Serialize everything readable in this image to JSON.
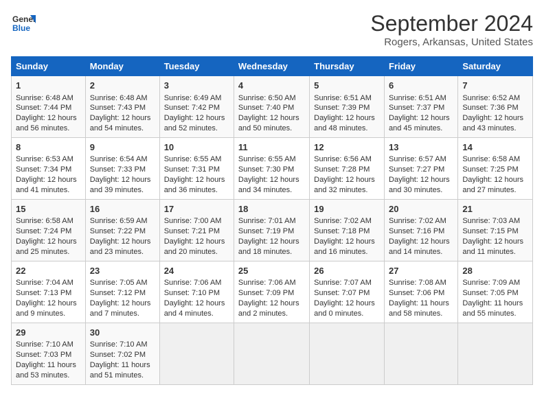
{
  "logo": {
    "line1": "General",
    "line2": "Blue"
  },
  "title": "September 2024",
  "subtitle": "Rogers, Arkansas, United States",
  "headers": [
    "Sunday",
    "Monday",
    "Tuesday",
    "Wednesday",
    "Thursday",
    "Friday",
    "Saturday"
  ],
  "weeks": [
    [
      {
        "day": "1",
        "lines": [
          "Sunrise: 6:48 AM",
          "Sunset: 7:44 PM",
          "Daylight: 12 hours",
          "and 56 minutes."
        ]
      },
      {
        "day": "2",
        "lines": [
          "Sunrise: 6:48 AM",
          "Sunset: 7:43 PM",
          "Daylight: 12 hours",
          "and 54 minutes."
        ]
      },
      {
        "day": "3",
        "lines": [
          "Sunrise: 6:49 AM",
          "Sunset: 7:42 PM",
          "Daylight: 12 hours",
          "and 52 minutes."
        ]
      },
      {
        "day": "4",
        "lines": [
          "Sunrise: 6:50 AM",
          "Sunset: 7:40 PM",
          "Daylight: 12 hours",
          "and 50 minutes."
        ]
      },
      {
        "day": "5",
        "lines": [
          "Sunrise: 6:51 AM",
          "Sunset: 7:39 PM",
          "Daylight: 12 hours",
          "and 48 minutes."
        ]
      },
      {
        "day": "6",
        "lines": [
          "Sunrise: 6:51 AM",
          "Sunset: 7:37 PM",
          "Daylight: 12 hours",
          "and 45 minutes."
        ]
      },
      {
        "day": "7",
        "lines": [
          "Sunrise: 6:52 AM",
          "Sunset: 7:36 PM",
          "Daylight: 12 hours",
          "and 43 minutes."
        ]
      }
    ],
    [
      {
        "day": "8",
        "lines": [
          "Sunrise: 6:53 AM",
          "Sunset: 7:34 PM",
          "Daylight: 12 hours",
          "and 41 minutes."
        ]
      },
      {
        "day": "9",
        "lines": [
          "Sunrise: 6:54 AM",
          "Sunset: 7:33 PM",
          "Daylight: 12 hours",
          "and 39 minutes."
        ]
      },
      {
        "day": "10",
        "lines": [
          "Sunrise: 6:55 AM",
          "Sunset: 7:31 PM",
          "Daylight: 12 hours",
          "and 36 minutes."
        ]
      },
      {
        "day": "11",
        "lines": [
          "Sunrise: 6:55 AM",
          "Sunset: 7:30 PM",
          "Daylight: 12 hours",
          "and 34 minutes."
        ]
      },
      {
        "day": "12",
        "lines": [
          "Sunrise: 6:56 AM",
          "Sunset: 7:28 PM",
          "Daylight: 12 hours",
          "and 32 minutes."
        ]
      },
      {
        "day": "13",
        "lines": [
          "Sunrise: 6:57 AM",
          "Sunset: 7:27 PM",
          "Daylight: 12 hours",
          "and 30 minutes."
        ]
      },
      {
        "day": "14",
        "lines": [
          "Sunrise: 6:58 AM",
          "Sunset: 7:25 PM",
          "Daylight: 12 hours",
          "and 27 minutes."
        ]
      }
    ],
    [
      {
        "day": "15",
        "lines": [
          "Sunrise: 6:58 AM",
          "Sunset: 7:24 PM",
          "Daylight: 12 hours",
          "and 25 minutes."
        ]
      },
      {
        "day": "16",
        "lines": [
          "Sunrise: 6:59 AM",
          "Sunset: 7:22 PM",
          "Daylight: 12 hours",
          "and 23 minutes."
        ]
      },
      {
        "day": "17",
        "lines": [
          "Sunrise: 7:00 AM",
          "Sunset: 7:21 PM",
          "Daylight: 12 hours",
          "and 20 minutes."
        ]
      },
      {
        "day": "18",
        "lines": [
          "Sunrise: 7:01 AM",
          "Sunset: 7:19 PM",
          "Daylight: 12 hours",
          "and 18 minutes."
        ]
      },
      {
        "day": "19",
        "lines": [
          "Sunrise: 7:02 AM",
          "Sunset: 7:18 PM",
          "Daylight: 12 hours",
          "and 16 minutes."
        ]
      },
      {
        "day": "20",
        "lines": [
          "Sunrise: 7:02 AM",
          "Sunset: 7:16 PM",
          "Daylight: 12 hours",
          "and 14 minutes."
        ]
      },
      {
        "day": "21",
        "lines": [
          "Sunrise: 7:03 AM",
          "Sunset: 7:15 PM",
          "Daylight: 12 hours",
          "and 11 minutes."
        ]
      }
    ],
    [
      {
        "day": "22",
        "lines": [
          "Sunrise: 7:04 AM",
          "Sunset: 7:13 PM",
          "Daylight: 12 hours",
          "and 9 minutes."
        ]
      },
      {
        "day": "23",
        "lines": [
          "Sunrise: 7:05 AM",
          "Sunset: 7:12 PM",
          "Daylight: 12 hours",
          "and 7 minutes."
        ]
      },
      {
        "day": "24",
        "lines": [
          "Sunrise: 7:06 AM",
          "Sunset: 7:10 PM",
          "Daylight: 12 hours",
          "and 4 minutes."
        ]
      },
      {
        "day": "25",
        "lines": [
          "Sunrise: 7:06 AM",
          "Sunset: 7:09 PM",
          "Daylight: 12 hours",
          "and 2 minutes."
        ]
      },
      {
        "day": "26",
        "lines": [
          "Sunrise: 7:07 AM",
          "Sunset: 7:07 PM",
          "Daylight: 12 hours",
          "and 0 minutes."
        ]
      },
      {
        "day": "27",
        "lines": [
          "Sunrise: 7:08 AM",
          "Sunset: 7:06 PM",
          "Daylight: 11 hours",
          "and 58 minutes."
        ]
      },
      {
        "day": "28",
        "lines": [
          "Sunrise: 7:09 AM",
          "Sunset: 7:05 PM",
          "Daylight: 11 hours",
          "and 55 minutes."
        ]
      }
    ],
    [
      {
        "day": "29",
        "lines": [
          "Sunrise: 7:10 AM",
          "Sunset: 7:03 PM",
          "Daylight: 11 hours",
          "and 53 minutes."
        ]
      },
      {
        "day": "30",
        "lines": [
          "Sunrise: 7:10 AM",
          "Sunset: 7:02 PM",
          "Daylight: 11 hours",
          "and 51 minutes."
        ]
      },
      {
        "day": "",
        "lines": []
      },
      {
        "day": "",
        "lines": []
      },
      {
        "day": "",
        "lines": []
      },
      {
        "day": "",
        "lines": []
      },
      {
        "day": "",
        "lines": []
      }
    ]
  ]
}
